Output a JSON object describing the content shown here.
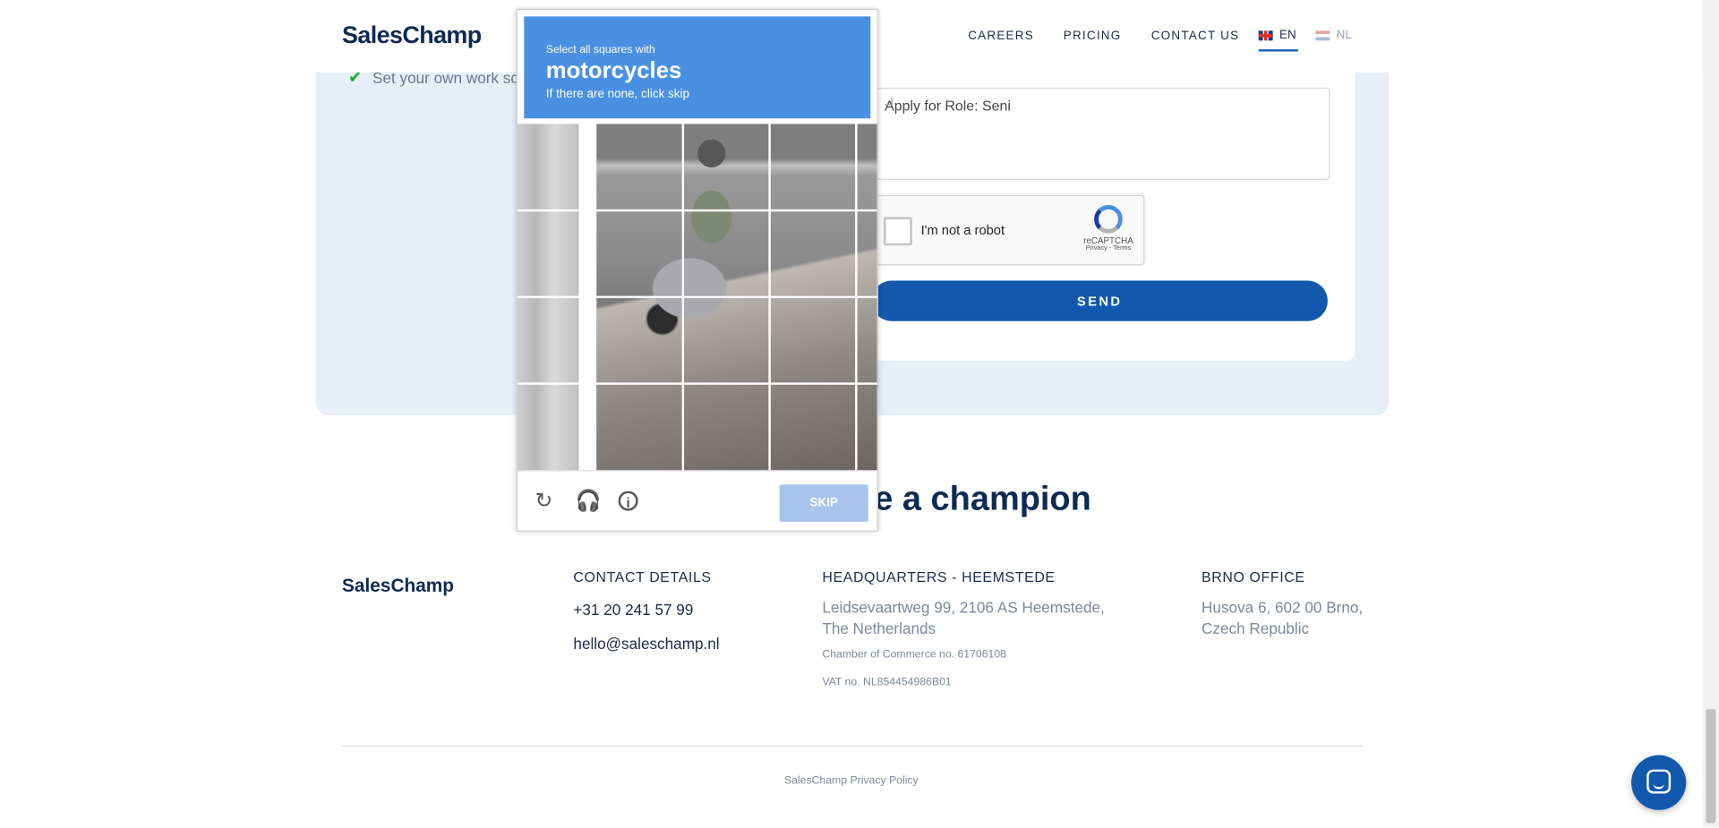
{
  "header": {
    "logo": "SalesChamp",
    "nav": {
      "careers": "CAREERS",
      "pricing": "PRICING",
      "contact": "CONTACT US"
    },
    "languages": {
      "en": "EN",
      "nl": "NL"
    }
  },
  "form": {
    "feature_text": "Set your own work sc",
    "message_value": "Apply for Role: Seni",
    "recaptcha_label": "I'm not a robot",
    "recaptcha_brand": "reCAPTCHA",
    "recaptcha_links": "Privacy - Terms",
    "send_label": "SEND"
  },
  "heading": "ke a champion",
  "footer": {
    "logo": "SalesChamp",
    "contact_title": "CONTACT DETAILS",
    "phone": "+31 20 241 57 99",
    "email": "hello@saleschamp.nl",
    "hq_title": "HEADQUARTERS - HEEMSTEDE",
    "hq_address_1": "Leidsevaartweg 99, 2106 AS Heemstede,",
    "hq_address_2": "The Netherlands",
    "coc": "Chamber of Commerce no. 61706108",
    "vat": "VAT no. NL854454986B01",
    "brno_title": "BRNO OFFICE",
    "brno_address_1": "Husova 6, 602 00 Brno,",
    "brno_address_2": "Czech Republic",
    "policy": "SalesChamp Privacy Policy"
  },
  "challenge": {
    "line1": "Select all squares with",
    "target": "motorcycles",
    "line3": "If there are none, click skip",
    "skip_label": "SKIP"
  },
  "colors": {
    "brand_blue": "#1259ad",
    "captcha_blue": "#4a90e2",
    "panel_bg": "#e6eef8"
  }
}
